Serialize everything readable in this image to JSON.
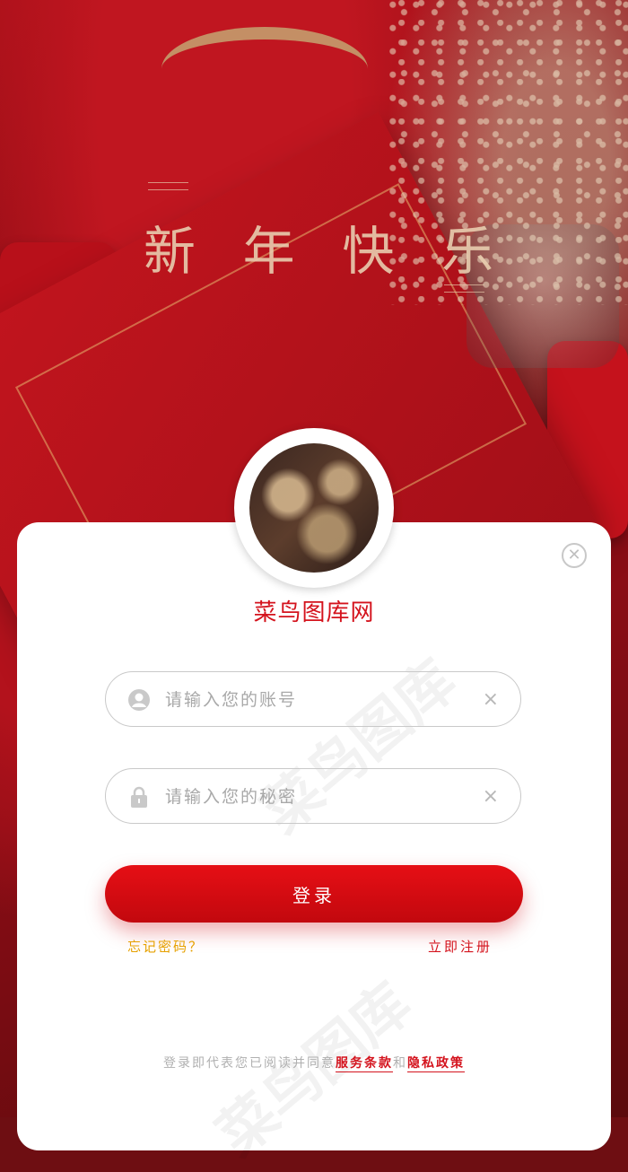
{
  "background": {
    "title_chars": [
      "新",
      "年",
      "快",
      "乐"
    ]
  },
  "card": {
    "brand_name": "菜鸟图库网",
    "watermark": "菜鸟图库",
    "close_icon": "close-icon",
    "account": {
      "placeholder": "请输入您的账号",
      "icon": "user-icon",
      "clear": "×"
    },
    "password": {
      "placeholder": "请输入您的秘密",
      "icon": "lock-icon",
      "clear": "×"
    },
    "login_label": "登录",
    "forgot_label": "忘记密码？",
    "register_label": "立即注册",
    "terms": {
      "prefix": "登录即代表您已阅读并同意",
      "service": "服务条款",
      "and": "和",
      "privacy": "隐私政策"
    }
  },
  "colors": {
    "accent": "#d4131d",
    "button": "#e60f15",
    "forgot": "#e6a100"
  }
}
